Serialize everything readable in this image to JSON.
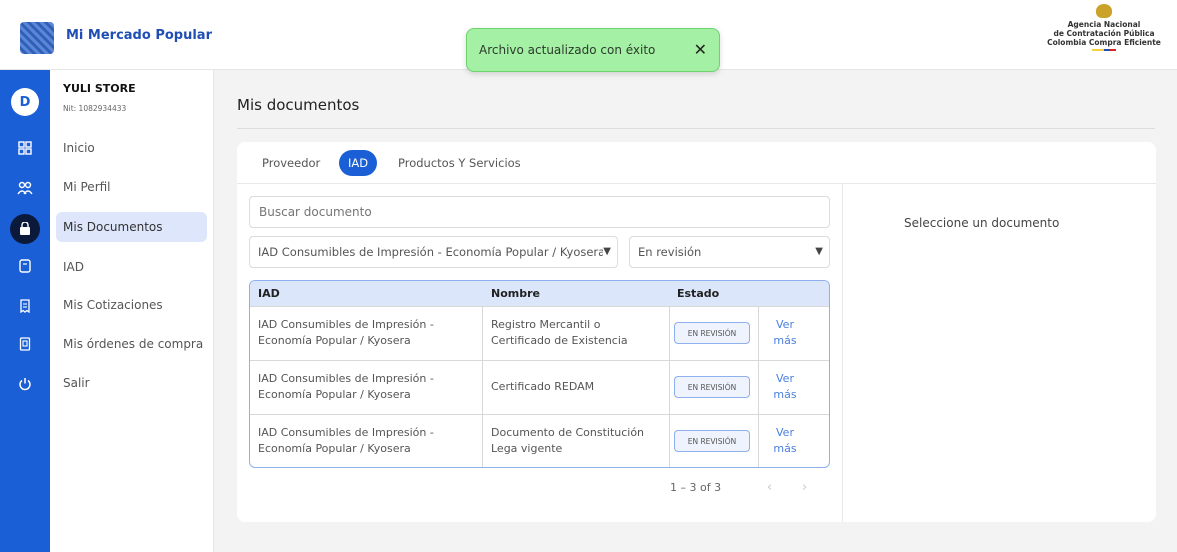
{
  "app": {
    "title": "Mi Mercado Popular"
  },
  "toast": {
    "message": "Archivo actualizado con éxito",
    "close_glyph": "✕"
  },
  "agency": {
    "line1": "Agencia Nacional",
    "line2": "de Contratación Pública",
    "line3": "Colombia Compra Eficiente"
  },
  "rail": {
    "avatar_letter": "D",
    "icons": [
      "dashboard-icon",
      "users-icon",
      "bag-icon",
      "document-icon",
      "receipt-icon",
      "orders-icon",
      "power-icon"
    ]
  },
  "store": {
    "name": "YULI STORE",
    "nit": "Nit: 1082934433"
  },
  "nav": {
    "inicio": "Inicio",
    "perfil": "Mi Perfil",
    "documentos": "Mis Documentos",
    "iad": "IAD",
    "cotizaciones": "Mis Cotizaciones",
    "ordenes": "Mis órdenes de compra",
    "salir": "Salir"
  },
  "page": {
    "title": "Mis documentos"
  },
  "tabs": {
    "proveedor": "Proveedor",
    "iad": "IAD",
    "productos": "Productos Y Servicios"
  },
  "search": {
    "placeholder": "Buscar documento"
  },
  "filters": {
    "iad_selected": "IAD Consumibles de Impresión - Economía Popular / Kyosera",
    "estado_selected": "En revisión"
  },
  "table": {
    "headers": {
      "iad": "IAD",
      "nombre": "Nombre",
      "estado": "Estado"
    },
    "rows": [
      {
        "iad_l1": "IAD Consumibles de Impresión -",
        "iad_l2": "Economía Popular / Kyosera",
        "nombre_l1": "Registro Mercantil o",
        "nombre_l2": "Certificado de Existencia",
        "estado": "EN REVISIÓN",
        "link_l1": "Ver",
        "link_l2": "más"
      },
      {
        "iad_l1": "IAD Consumibles de Impresión -",
        "iad_l2": "Economía Popular / Kyosera",
        "nombre_l1": "Certificado REDAM",
        "nombre_l2": "",
        "estado": "EN REVISIÓN",
        "link_l1": "Ver",
        "link_l2": "más"
      },
      {
        "iad_l1": "IAD Consumibles de Impresión -",
        "iad_l2": "Economía Popular / Kyosera",
        "nombre_l1": "Documento de Constitución",
        "nombre_l2": "Lega vigente",
        "estado": "EN REVISIÓN",
        "link_l1": "Ver",
        "link_l2": "más"
      }
    ]
  },
  "pagination": {
    "range": "1 – 3 of 3",
    "prev": "‹",
    "next": "›"
  },
  "detail": {
    "empty_message": "Seleccione un documento"
  },
  "colors": {
    "primary": "#1a5fd6",
    "toast_bg": "#a4f0a4",
    "header_bg": "#dbe6fb"
  }
}
